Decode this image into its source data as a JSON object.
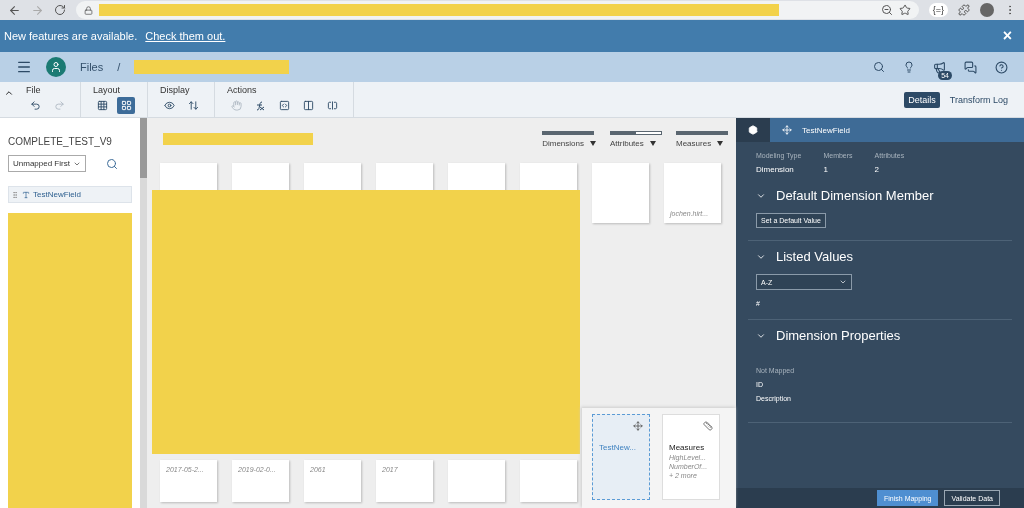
{
  "browser": {
    "extension_label": "{=}"
  },
  "banner": {
    "text": "New features are available.",
    "link": "Check them out.",
    "close": "×"
  },
  "shell": {
    "breadcrumb": "Files",
    "separator": "/",
    "badge": "54"
  },
  "toolbar": {
    "groups": [
      {
        "label": "File",
        "tools": [
          {
            "kind": "undo",
            "disabled": false,
            "selected": false
          },
          {
            "kind": "redo",
            "disabled": true,
            "selected": false
          }
        ]
      },
      {
        "label": "Layout",
        "tools": [
          {
            "kind": "grid",
            "disabled": false,
            "selected": false
          },
          {
            "kind": "cards",
            "disabled": false,
            "selected": true
          }
        ]
      },
      {
        "label": "Display",
        "tools": [
          {
            "kind": "eye",
            "disabled": false,
            "selected": false
          },
          {
            "kind": "sort",
            "disabled": false,
            "selected": false
          }
        ]
      },
      {
        "label": "Actions",
        "tools": [
          {
            "kind": "hand",
            "disabled": true,
            "selected": false
          },
          {
            "kind": "formula",
            "disabled": false,
            "selected": false
          },
          {
            "kind": "code",
            "disabled": false,
            "selected": false
          },
          {
            "kind": "split",
            "disabled": false,
            "selected": false
          },
          {
            "kind": "merge",
            "disabled": false,
            "selected": false
          }
        ]
      }
    ],
    "view_tabs": [
      {
        "label": "Details",
        "selected": true
      },
      {
        "label": "Transform Log",
        "selected": false
      }
    ]
  },
  "dataset": {
    "title": "COMPLETE_TEST_V9",
    "sort": "Unmapped First",
    "fields": [
      {
        "label": "TestNewField"
      }
    ]
  },
  "filters": [
    {
      "label": "Dimensions",
      "level": 1
    },
    {
      "label": "Attributes",
      "level": 0.5
    },
    {
      "label": "Measures",
      "level": 1
    }
  ],
  "cards": {
    "top": [
      {
        "kind": "blank"
      },
      {
        "kind": "blank"
      },
      {
        "kind": "blank"
      },
      {
        "kind": "blank"
      },
      {
        "kind": "blank"
      },
      {
        "kind": "blank"
      },
      {
        "kind": "blank"
      },
      {
        "kind": "text",
        "lines": [
          "jochen.hirt..."
        ]
      }
    ],
    "bottom": [
      {
        "kind": "text",
        "lines": [
          "2017-05-2..."
        ]
      },
      {
        "kind": "text",
        "lines": [
          "2019-02-0..."
        ]
      },
      {
        "kind": "text",
        "lines": [
          "2061"
        ]
      },
      {
        "kind": "text",
        "lines": [
          "2017"
        ]
      },
      {
        "kind": "blank"
      },
      {
        "kind": "blank"
      }
    ]
  },
  "tray": [
    {
      "kind": "dimension",
      "title": "TestNew...",
      "selected": true
    },
    {
      "kind": "measure",
      "title": "Measures",
      "selected": false,
      "lines": [
        "HighLevel...",
        "NumberOf...",
        "+ 2 more"
      ]
    }
  ],
  "details": {
    "tabs": [
      {
        "kind": "settings",
        "selected": true
      },
      {
        "kind": "dimension",
        "label": "TestNewField",
        "selected": false
      }
    ],
    "stats": [
      {
        "label": "Modeling Type",
        "value": "Dimension"
      },
      {
        "label": "Members",
        "value": "1"
      },
      {
        "label": "Attributes",
        "value": "2"
      }
    ],
    "sections": [
      {
        "kind": "button",
        "title": "Default Dimension Member",
        "expanded": true,
        "button": "Set a Default Value"
      },
      {
        "kind": "select",
        "title": "Listed Values",
        "expanded": true,
        "value": "A-Z",
        "items": [
          "#"
        ]
      },
      {
        "kind": "properties",
        "title": "Dimension Properties",
        "expanded": true,
        "caption": "Not Mapped",
        "items": [
          "ID",
          "Description"
        ]
      }
    ]
  },
  "footer": [
    {
      "label": "Finish Mapping",
      "primary": true
    },
    {
      "label": "Validate Data",
      "primary": false
    }
  ]
}
